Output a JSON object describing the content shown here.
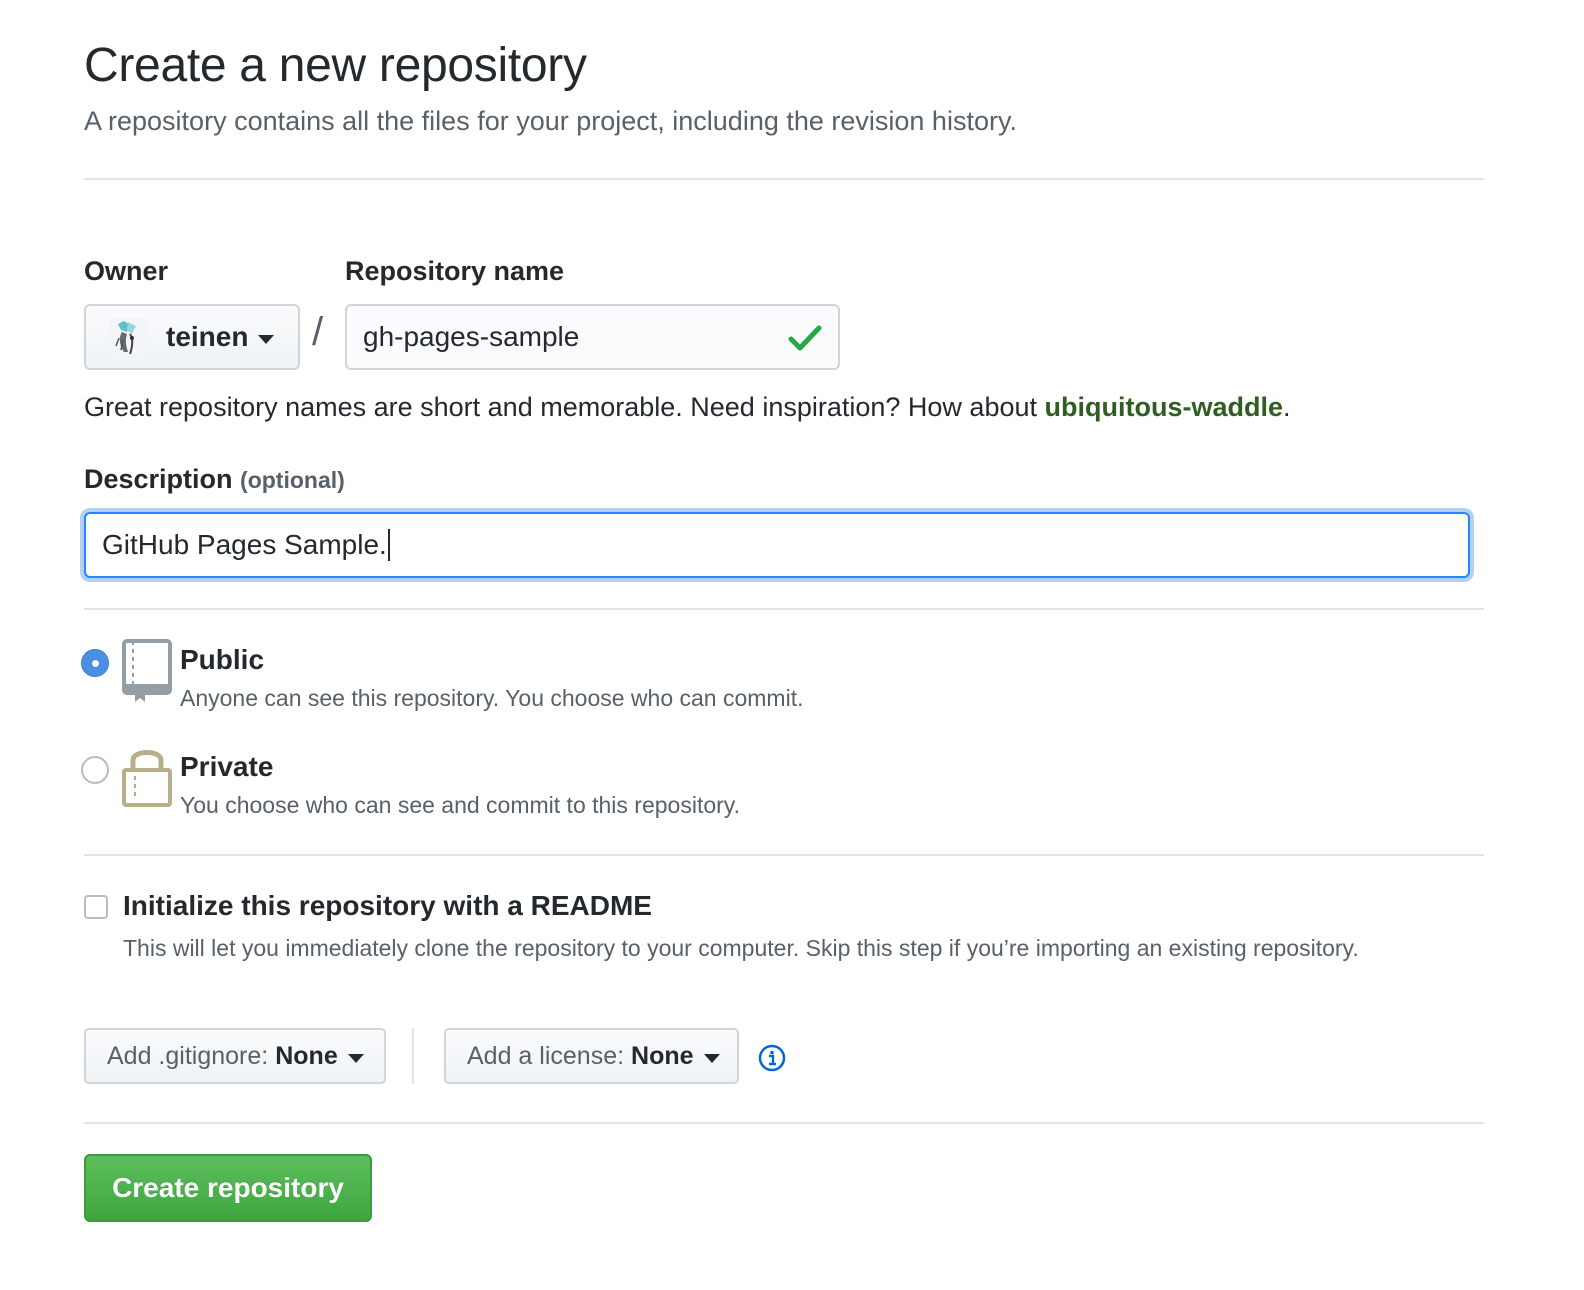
{
  "header": {
    "title": "Create a new repository",
    "subtitle": "A repository contains all the files for your project, including the revision history."
  },
  "owner": {
    "label": "Owner",
    "value": "teinen"
  },
  "repo_name": {
    "label": "Repository name",
    "value": "gh-pages-sample",
    "separator": "/",
    "valid": true
  },
  "inspiration": {
    "text": "Great repository names are short and memorable. Need inspiration? How about ",
    "suggestion": "ubiquitous-waddle",
    "end": "."
  },
  "description": {
    "label": "Description",
    "optional": "(optional)",
    "value": "GitHub Pages Sample."
  },
  "visibility": {
    "selected": "public",
    "public": {
      "title": "Public",
      "note": "Anyone can see this repository. You choose who can commit."
    },
    "private": {
      "title": "Private",
      "note": "You choose who can see and commit to this repository."
    }
  },
  "readme": {
    "checked": false,
    "title": "Initialize this repository with a README",
    "note": "This will let you immediately clone the repository to your computer. Skip this step if you’re importing an existing repository."
  },
  "gitignore": {
    "label": "Add .gitignore:",
    "value": "None"
  },
  "license": {
    "label": "Add a license:",
    "value": "None"
  },
  "submit": {
    "label": "Create repository"
  },
  "colors": {
    "accent": "#4a90e2",
    "success": "#28a745",
    "link_green": "#2f5e20",
    "book_icon": "#959da5",
    "lock_icon": "#b8ae8a",
    "info_icon": "#0366d6"
  },
  "icons": {
    "check": "check-icon",
    "book": "repo-icon",
    "lock": "lock-icon",
    "info": "info-icon",
    "caret": "caret-down-icon"
  }
}
